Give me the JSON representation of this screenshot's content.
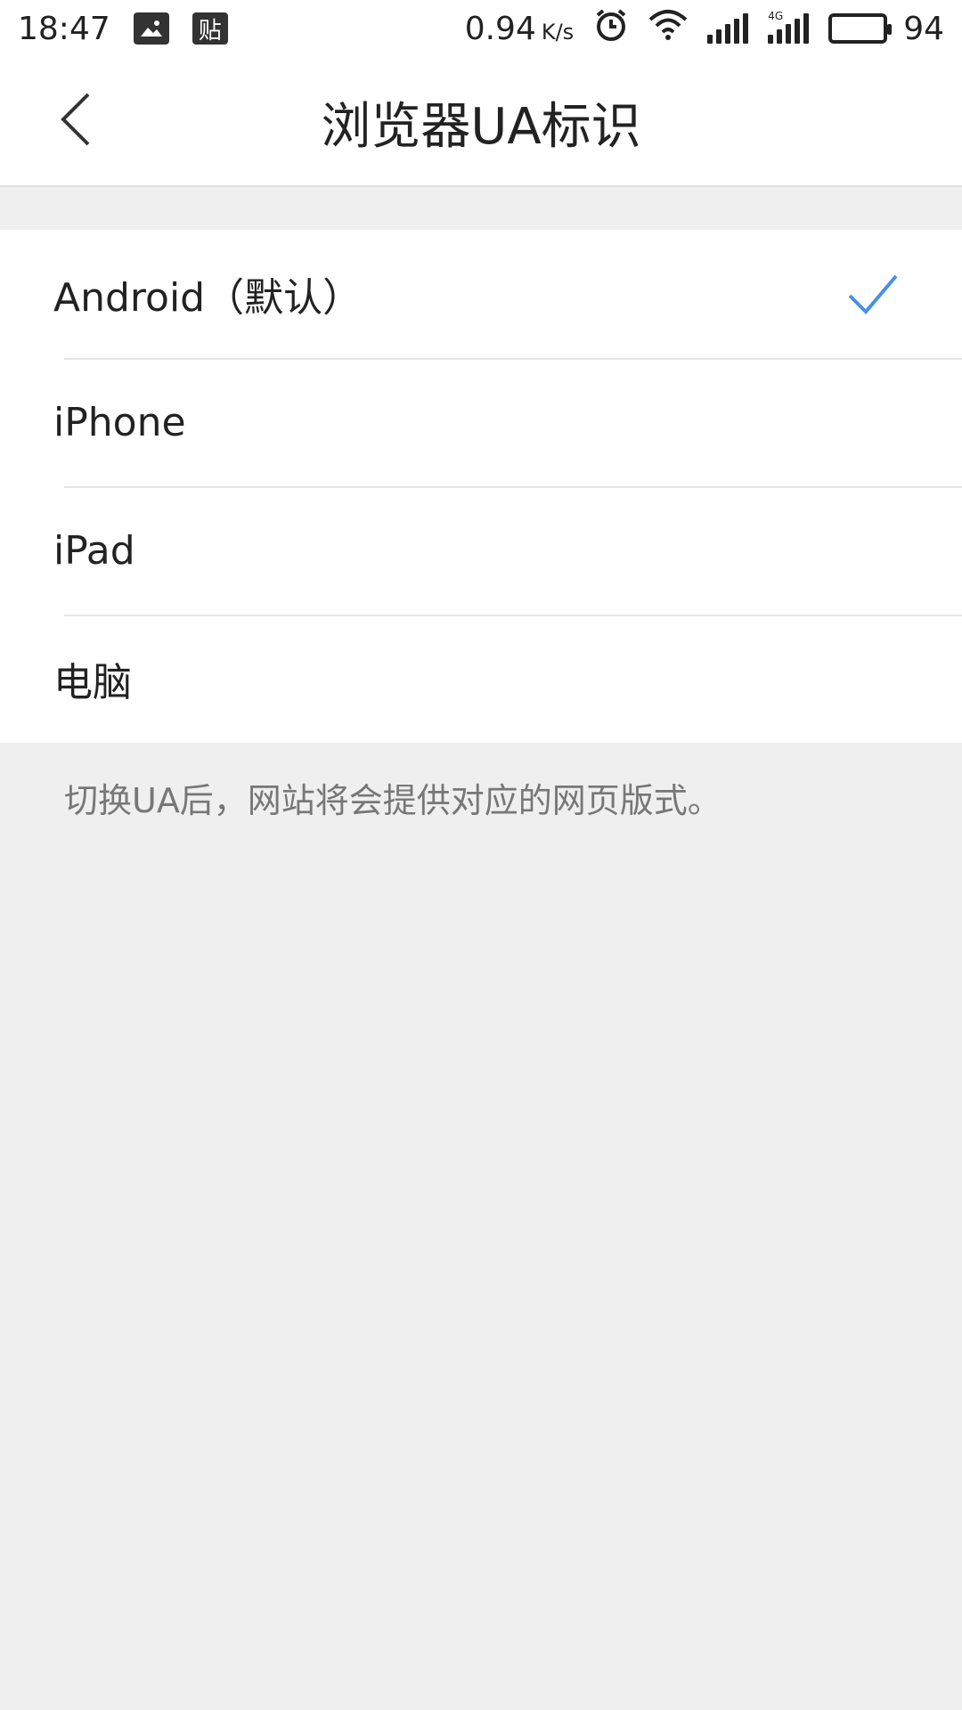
{
  "status_bar": {
    "time": "18:47",
    "notif_icons": [
      "image-icon",
      "tieba-icon"
    ],
    "notif_text": "贴",
    "net_speed": "0.94",
    "net_unit": "K/s",
    "battery": "94",
    "battery_level": 0.94,
    "network_type": "4G"
  },
  "app_bar": {
    "back_icon": "chevron-left-icon",
    "title": "浏览器UA标识"
  },
  "options": [
    {
      "label": "Android（默认）",
      "selected": true
    },
    {
      "label": "iPhone",
      "selected": false
    },
    {
      "label": "iPad",
      "selected": false
    },
    {
      "label": "电脑",
      "selected": false
    }
  ],
  "hint": "切换UA后，网站将会提供对应的网页版式。",
  "colors": {
    "accent": "#4a90e2",
    "background": "#efefef",
    "surface": "#ffffff",
    "text": "#222222",
    "hint_text": "#777777"
  }
}
